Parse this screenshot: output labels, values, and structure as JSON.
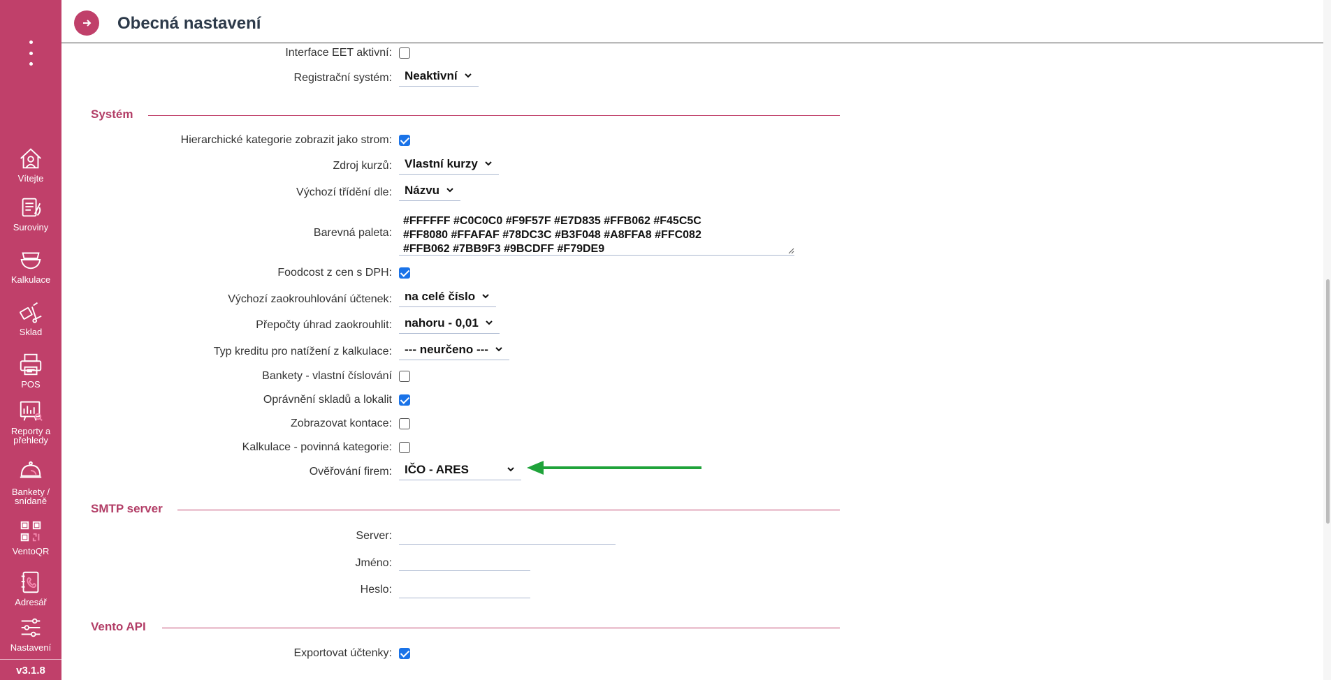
{
  "sidebar": {
    "items": [
      {
        "label": "Vítejte",
        "icon": "home-icon"
      },
      {
        "label": "Suroviny",
        "icon": "ingredients-icon"
      },
      {
        "label": "Kalkulace",
        "icon": "bowl-icon"
      },
      {
        "label": "Sklad",
        "icon": "cart-icon"
      },
      {
        "label": "POS",
        "icon": "printer-icon"
      },
      {
        "label": "Reporty a přehledy",
        "icon": "report-icon"
      },
      {
        "label": "Bankety / snídaně",
        "icon": "cloche-icon"
      },
      {
        "label": "VentoQR",
        "icon": "qr-icon"
      },
      {
        "label": "Adresář",
        "icon": "address-book-icon"
      },
      {
        "label": "Nastavení",
        "icon": "settings-icon"
      }
    ],
    "version": "v3.1.8"
  },
  "header": {
    "title": "Obecná nastavení"
  },
  "fields": {
    "eet": {
      "label": "Interface EET aktivní:",
      "checked": false
    },
    "registracni": {
      "label": "Registrační systém:",
      "value": "Neaktivní"
    },
    "hierarchicke": {
      "label": "Hierarchické kategorie zobrazit jako strom:",
      "checked": true
    },
    "zdroj_kurzu": {
      "label": "Zdroj kurzů:",
      "value": "Vlastní kurzy"
    },
    "trideni": {
      "label": "Výchozí třídění dle:",
      "value": "Názvu"
    },
    "paleta": {
      "label": "Barevná paleta:",
      "lines": [
        "#FFFFFF #C0C0C0 #F9F57F #E7D835 #FFB062 #F45C5C",
        "#FF8080 #FFAFAF #78DC3C #B3F048 #A8FFA8 #FFC082",
        "#FFB062 #7BB9F3 #9BCDFF #F79DE9"
      ]
    },
    "foodcost": {
      "label": "Foodcost z cen s DPH:",
      "checked": true
    },
    "zaokrouhlovani": {
      "label": "Výchozí zaokrouhlování účtenek:",
      "value": "na celé číslo"
    },
    "prepocty": {
      "label": "Přepočty úhrad zaokrouhlit:",
      "value": "nahoru - 0,01"
    },
    "typ_kreditu": {
      "label": "Typ kreditu pro natížení z kalkulace:",
      "value": "--- neurčeno ---"
    },
    "bankety": {
      "label": "Bankety - vlastní číslování",
      "checked": false
    },
    "opravneni": {
      "label": "Oprávnění skladů a lokalit",
      "checked": true
    },
    "kontace": {
      "label": "Zobrazovat kontace:",
      "checked": false
    },
    "kalkulace_kat": {
      "label": "Kalkulace - povinná kategorie:",
      "checked": false
    },
    "overovani": {
      "label": "Ověřování firem:",
      "value": "IČO - ARES"
    },
    "server": {
      "label": "Server:",
      "value": ""
    },
    "jmeno": {
      "label": "Jméno:",
      "value": ""
    },
    "heslo": {
      "label": "Heslo:",
      "value": ""
    },
    "exportovat": {
      "label": "Exportovat účtenky:",
      "checked": true
    }
  },
  "sections": {
    "system": "Systém",
    "smtp": "SMTP server",
    "api": "Vento API"
  },
  "colors": {
    "sidebar": "#c0406a",
    "accent": "#b23d66",
    "checkbox": "#1a73e8",
    "arrow": "#1fa33a"
  }
}
